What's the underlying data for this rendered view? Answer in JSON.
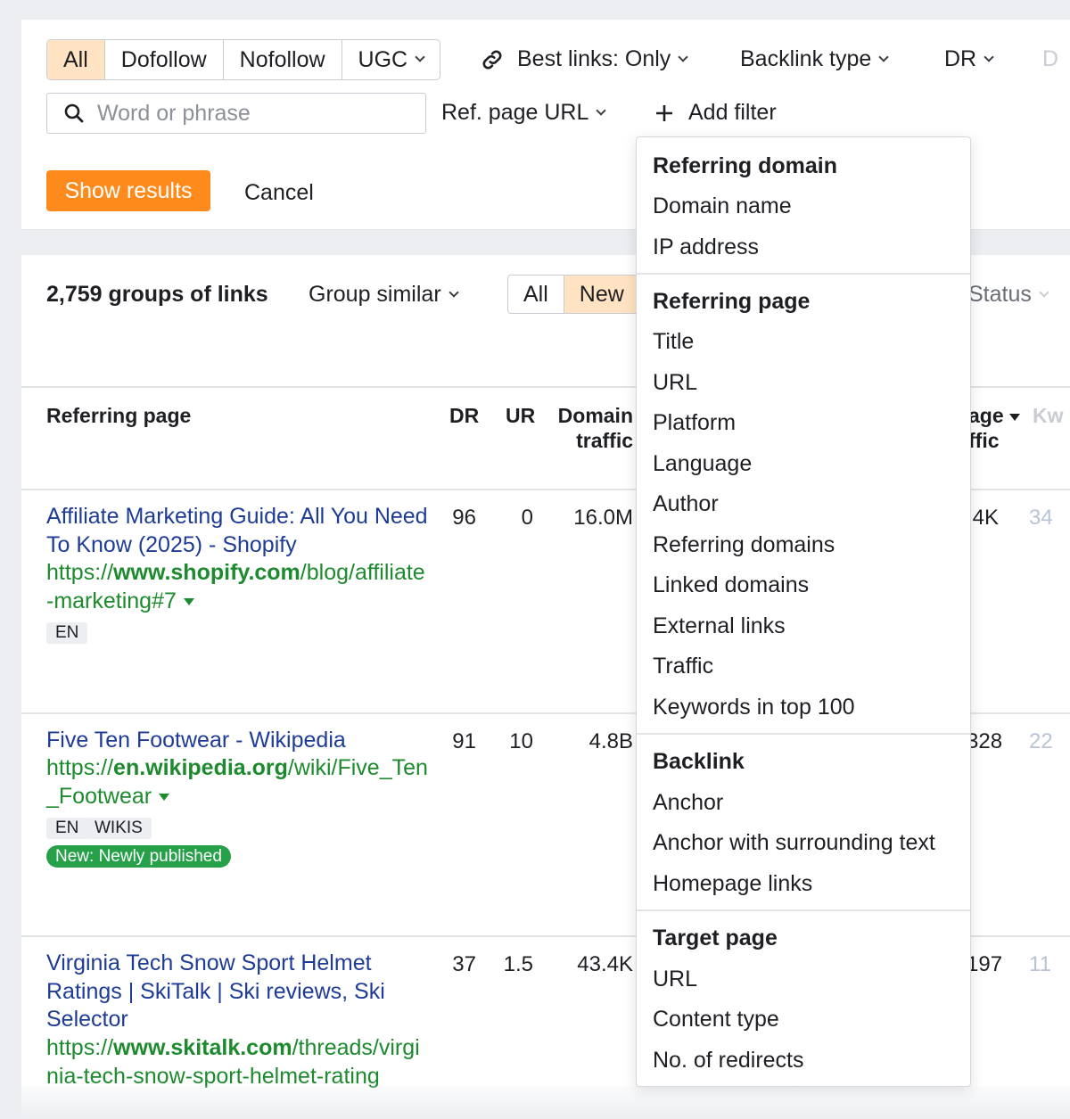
{
  "filters": {
    "link_type": [
      "All",
      "Dofollow",
      "Nofollow",
      "UGC"
    ],
    "best_links": "Best links: Only",
    "backlink_type": "Backlink type",
    "dr": "DR",
    "cut_item": "D",
    "search_placeholder": "Word or phrase",
    "ref_page_url": "Ref. page URL",
    "add_filter": "Add filter",
    "show_results": "Show results",
    "cancel": "Cancel"
  },
  "results": {
    "count": "2,759 groups of links",
    "group_similar": "Group similar",
    "segment": [
      "All",
      "New"
    ],
    "status": "Status",
    "columns": {
      "referring_page": "Referring page",
      "dr": "DR",
      "ur": "UR",
      "domain_traffic_1": "Domain",
      "domain_traffic_2": "traffic",
      "page_traffic_1": "age",
      "page_traffic_2": "ffic",
      "kw": "Kw"
    },
    "rows": [
      {
        "title": "Affiliate Marketing Guide: All You Need To Know (2025) - Shopify",
        "url_prefix": "https://",
        "url_domain": "www.shopify.com",
        "url_path": "/blog/affiliate-marketing#7",
        "tags": [
          "EN"
        ],
        "dr": "96",
        "ur": "0",
        "domain_traffic": "16.0M",
        "page_traffic": ".4K",
        "kw": "34"
      },
      {
        "title": "Five Ten Footwear - Wikipedia",
        "url_prefix": "https://",
        "url_domain": "en.wikipedia.org",
        "url_path": "/wiki/Five_Ten_Footwear",
        "tags": [
          "EN",
          "WIKIS"
        ],
        "badge": "New: Newly published",
        "dr": "91",
        "ur": "10",
        "domain_traffic": "4.8B",
        "page_traffic": "328",
        "kw": "22"
      },
      {
        "title": "Virginia Tech Snow Sport Helmet Ratings | SkiTalk | Ski reviews, Ski Selector",
        "url_prefix": "https://",
        "url_domain": "www.skitalk.com",
        "url_path": "/threads/virginia-tech-snow-sport-helmet-rating",
        "dr": "37",
        "ur": "1.5",
        "domain_traffic": "43.4K",
        "page_traffic": "197",
        "kw": "11"
      }
    ]
  },
  "menu": {
    "sections": [
      {
        "header": "Referring domain",
        "items": [
          "Domain name",
          "IP address"
        ]
      },
      {
        "header": "Referring page",
        "items": [
          "Title",
          "URL",
          "Platform",
          "Language",
          "Author",
          "Referring domains",
          "Linked domains",
          "External links",
          "Traffic",
          "Keywords in top 100"
        ]
      },
      {
        "header": "Backlink",
        "items": [
          "Anchor",
          "Anchor with surrounding text",
          "Homepage links"
        ]
      },
      {
        "header": "Target page",
        "items": [
          "URL",
          "Content type",
          "No. of redirects"
        ]
      }
    ]
  },
  "colors": {
    "accent": "#ff8a1c",
    "active_segment": "#ffe3c2",
    "link_title": "#1e3c96",
    "url_green": "#1d8a2e",
    "badge_green": "#27a04a"
  }
}
